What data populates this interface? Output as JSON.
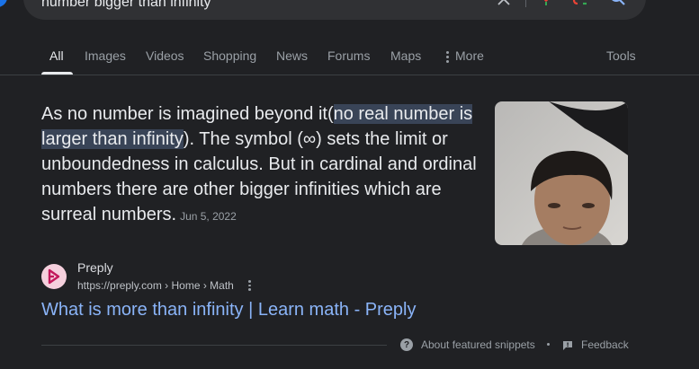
{
  "search": {
    "query": "number bigger than infinity"
  },
  "tabs": {
    "items": [
      {
        "label": "All"
      },
      {
        "label": "Images"
      },
      {
        "label": "Videos"
      },
      {
        "label": "Shopping"
      },
      {
        "label": "News"
      },
      {
        "label": "Forums"
      },
      {
        "label": "Maps"
      },
      {
        "label": "More"
      }
    ],
    "tools": "Tools",
    "active": "All"
  },
  "snippet": {
    "part1": "As no number is imagined beyond it(",
    "highlight": "no real number is larger than infinity",
    "part2": "). The symbol (∞) sets the limit or unboundedness in calculus. But in cardinal and ordinal numbers there are other bigger infinities which are surreal numbers.",
    "date": "Jun 5, 2022",
    "highlight_color": "#394457"
  },
  "source": {
    "name": "Preply",
    "url": "https://preply.com › Home › Math",
    "title": "What is more than infinity | Learn math - Preply",
    "link_color": "#8ab4f8"
  },
  "footer": {
    "about": "About featured snippets",
    "feedback": "Feedback"
  },
  "icons": {
    "clear": "close-icon",
    "mic": "microphone-icon",
    "lens": "lens-icon",
    "search": "search-icon",
    "more": "more-vertical-icon",
    "about": "help-icon",
    "feedback": "feedback-icon"
  }
}
